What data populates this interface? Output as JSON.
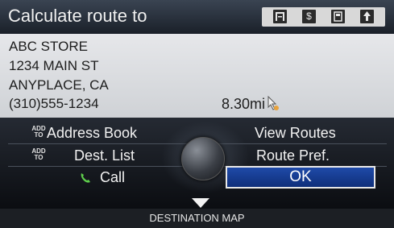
{
  "header": {
    "title": "Calculate route to",
    "icons": [
      "tollgate-icon",
      "dollar-icon",
      "memory-icon",
      "navigation-icon"
    ]
  },
  "destination": {
    "name": "ABC STORE",
    "street": "1234 MAIN ST",
    "city": "ANYPLACE, CA",
    "phone": "(310)555-1234",
    "distance": "8.30mi"
  },
  "menu": {
    "address_book": "Address Book",
    "dest_list": "Dest. List",
    "call": "Call",
    "view_routes": "View Routes",
    "route_pref": "Route Pref.",
    "ok": "OK",
    "add_to_line1": "ADD",
    "add_to_line2": "TO"
  },
  "footer": {
    "label": "DESTINATION MAP"
  }
}
